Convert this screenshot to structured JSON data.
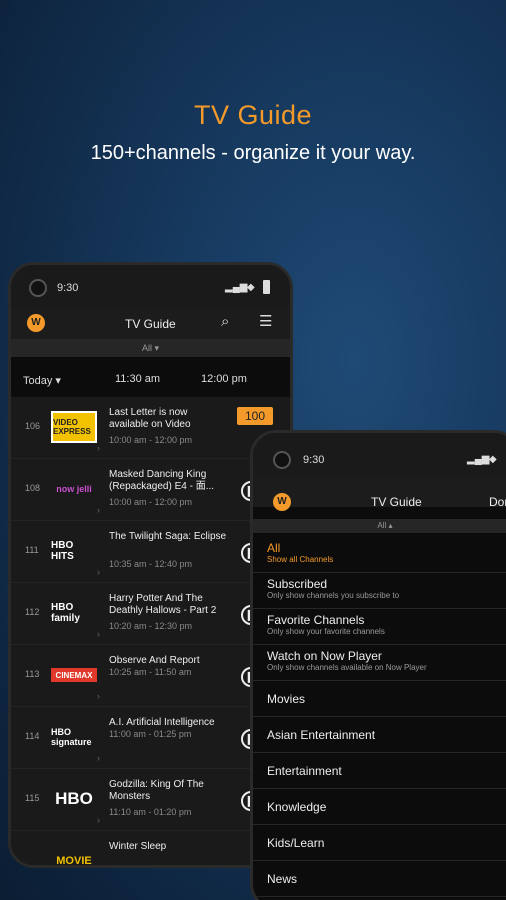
{
  "hero": {
    "title": "TV Guide",
    "subtitle": "150+channels - organize it your way."
  },
  "phone1": {
    "time": "9:30",
    "nav_title": "TV Guide",
    "logo": "W",
    "filter": "All ▾",
    "today": "Today ▾",
    "times": [
      "11:30 am",
      "12:00 pm"
    ],
    "badge": "100",
    "channels": [
      {
        "num": "106",
        "logo": "VIDEO EXPRESS",
        "logo_color": "#f2c200",
        "title": "Last Letter is now available on Video",
        "time": "10:00 am - 12:00 pm"
      },
      {
        "num": "108",
        "logo": "now jelli",
        "logo_color": "#c84fd0",
        "title": "Masked Dancing King (Repackaged) E4 - 面...",
        "time": "10:00 am - 12:00 pm"
      },
      {
        "num": "111",
        "logo": "HBO HITS",
        "logo_color": "#ffffff",
        "title": "The Twilight Saga: Eclipse",
        "time": "10:35 am - 12:40 pm"
      },
      {
        "num": "112",
        "logo": "HBO family",
        "logo_color": "#ffffff",
        "title": "Harry Potter And The Deathly Hallows - Part 2",
        "time": "10:20 am - 12:30 pm"
      },
      {
        "num": "113",
        "logo": "CINEMAX",
        "logo_color": "#e0382b",
        "title": "Observe And Report",
        "time": "10:25 am - 11:50 am"
      },
      {
        "num": "114",
        "logo": "HBO signature",
        "logo_color": "#ffffff",
        "title": "A.I. Artificial Intelligence",
        "time": "11:00 am - 01:25 pm"
      },
      {
        "num": "115",
        "logo": "HBO",
        "logo_color": "#ffffff",
        "title": "Godzilla: King Of The Monsters",
        "time": "11:10 am - 01:20 pm"
      },
      {
        "num": "",
        "logo": "MOVIE",
        "logo_color": "#f2c200",
        "title": "Winter Sleep",
        "time": ""
      }
    ]
  },
  "phone2": {
    "time": "9:30",
    "nav_title": "TV Guide",
    "nav_action": "Done",
    "logo": "W",
    "filter": "All ▴",
    "menu": [
      {
        "label": "All",
        "sub": "Show all Channels",
        "selected": true
      },
      {
        "label": "Subscribed",
        "sub": "Only show channels you subscribe to"
      },
      {
        "label": "Favorite Channels",
        "sub": "Only show your favorite channels"
      },
      {
        "label": "Watch on Now Player",
        "sub": "Only show channels available on Now Player"
      },
      {
        "label": "Movies",
        "sub": ""
      },
      {
        "label": "Asian Entertainment",
        "sub": ""
      },
      {
        "label": "Entertainment",
        "sub": ""
      },
      {
        "label": "Knowledge",
        "sub": ""
      },
      {
        "label": "Kids/Learn",
        "sub": ""
      },
      {
        "label": "News",
        "sub": ""
      }
    ]
  }
}
